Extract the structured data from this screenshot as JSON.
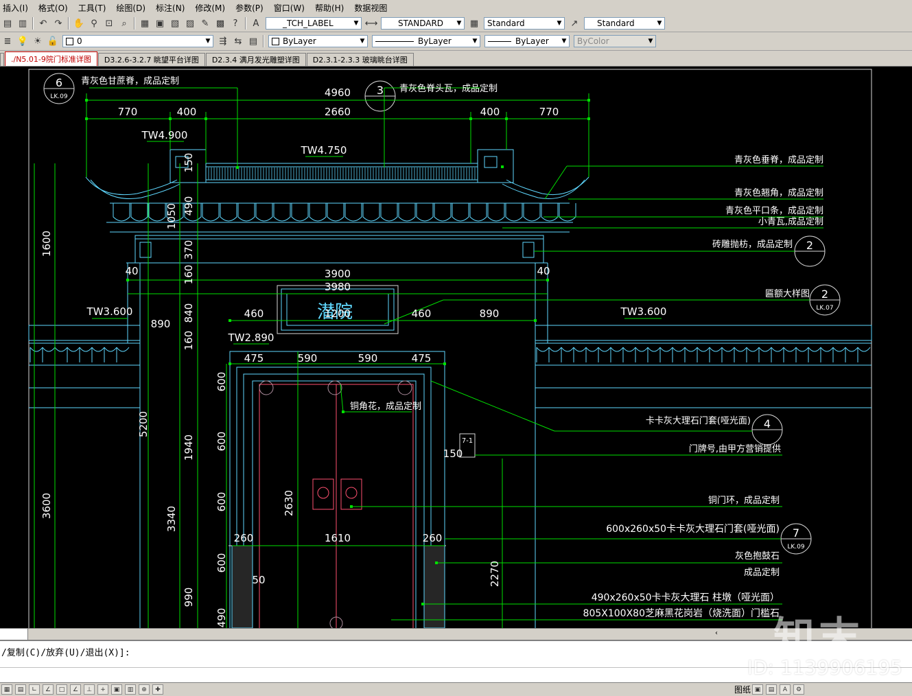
{
  "menu": [
    "插入(I)",
    "格式(O)",
    "工具(T)",
    "绘图(D)",
    "标注(N)",
    "修改(M)",
    "参数(P)",
    "窗口(W)",
    "帮助(H)",
    "数据视图"
  ],
  "toolbar": {
    "text_style": "_TCH_LABEL",
    "dim_style": "STANDARD",
    "table_style": "Standard",
    "mleader_style": "Standard",
    "layer": "0",
    "color": "ByLayer",
    "linetype": "ByLayer",
    "lineweight": "ByLayer",
    "plotstyle": "ByColor"
  },
  "tabs": [
    "./N5.01-9院门标准详图",
    "D3.2.6-3.2.7 眺望平台详图",
    "D2.3.4 满月发光雕塑详图",
    "D2.3.1-2.3.3 玻璃眺台详图"
  ],
  "drawing": {
    "top_dims": [
      "4960",
      "770",
      "400",
      "2660",
      "400",
      "770"
    ],
    "elev": [
      "TW4.900",
      "TW4.750",
      "TW3.600",
      "TW3.600",
      "TW2.890"
    ],
    "mid_dims": [
      "3900",
      "3980",
      "460",
      "1200",
      "460",
      "890",
      "890",
      "40",
      "40"
    ],
    "door_dims": [
      "475",
      "590",
      "590",
      "475",
      "1610",
      "260",
      "260",
      "150",
      "50"
    ],
    "left_vert": [
      "1600",
      "3600",
      "5200",
      "3340",
      "1050",
      "150",
      "490",
      "370",
      "160",
      "840",
      "160",
      "1940",
      "990",
      "600",
      "600",
      "600",
      "600",
      "490",
      "2630",
      "2270"
    ],
    "plaque": "潜院",
    "callouts": {
      "c6": "6",
      "c6_sub": "LK.09",
      "c3": "3",
      "c2a": "2",
      "c2b": "2",
      "c2b_sub": "LK.07",
      "c4": "4",
      "c7": "7",
      "c7_sub": "LK.09",
      "c71": "7-1"
    },
    "labels": {
      "l1": "青灰色甘蔗脊，成品定制",
      "l2": "青灰色脊头瓦，成品定制",
      "l3": "青灰色垂脊，成品定制",
      "l4": "青灰色翘角，成品定制",
      "l5": "青灰色平口条，成品定制",
      "l6": "小青瓦,成品定制",
      "l7": "砖雕抛枋，成品定制",
      "l8": "匾额大样图",
      "l9": "铜角花，成品定制",
      "l10": "卡卡灰大理石门套(哑光面)",
      "l11": "门牌号,由甲方营销提供",
      "l12": "铜门环，成品定制",
      "l13": "600x260x50卡卡灰大理石门套(哑光面)",
      "l14": "灰色抱鼓石",
      "l15": "成品定制",
      "l16": "490x260x50卡卡灰大理石 柱墩（哑光面）",
      "l17": "805X100X80芝麻黑花岗岩（烧洗面）门槛石"
    }
  },
  "command": "/复制(C)/放弃(U)/退出(X)]:",
  "status": {
    "paper": "图纸"
  },
  "watermark": {
    "brand": "知末",
    "id": "ID: 1139906195"
  }
}
